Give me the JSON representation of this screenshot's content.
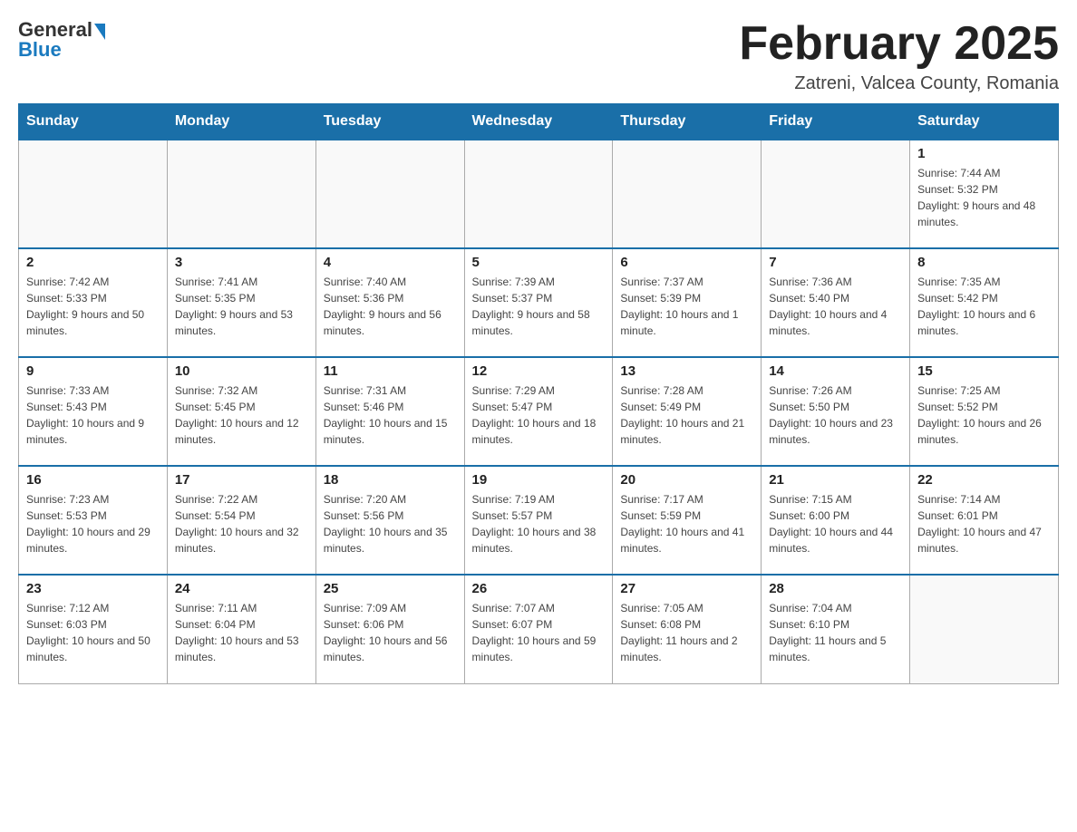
{
  "header": {
    "logo_general": "General",
    "logo_blue": "Blue",
    "title": "February 2025",
    "subtitle": "Zatreni, Valcea County, Romania"
  },
  "days_of_week": [
    "Sunday",
    "Monday",
    "Tuesday",
    "Wednesday",
    "Thursday",
    "Friday",
    "Saturday"
  ],
  "weeks": [
    [
      {
        "day": "",
        "info": ""
      },
      {
        "day": "",
        "info": ""
      },
      {
        "day": "",
        "info": ""
      },
      {
        "day": "",
        "info": ""
      },
      {
        "day": "",
        "info": ""
      },
      {
        "day": "",
        "info": ""
      },
      {
        "day": "1",
        "info": "Sunrise: 7:44 AM\nSunset: 5:32 PM\nDaylight: 9 hours and 48 minutes."
      }
    ],
    [
      {
        "day": "2",
        "info": "Sunrise: 7:42 AM\nSunset: 5:33 PM\nDaylight: 9 hours and 50 minutes."
      },
      {
        "day": "3",
        "info": "Sunrise: 7:41 AM\nSunset: 5:35 PM\nDaylight: 9 hours and 53 minutes."
      },
      {
        "day": "4",
        "info": "Sunrise: 7:40 AM\nSunset: 5:36 PM\nDaylight: 9 hours and 56 minutes."
      },
      {
        "day": "5",
        "info": "Sunrise: 7:39 AM\nSunset: 5:37 PM\nDaylight: 9 hours and 58 minutes."
      },
      {
        "day": "6",
        "info": "Sunrise: 7:37 AM\nSunset: 5:39 PM\nDaylight: 10 hours and 1 minute."
      },
      {
        "day": "7",
        "info": "Sunrise: 7:36 AM\nSunset: 5:40 PM\nDaylight: 10 hours and 4 minutes."
      },
      {
        "day": "8",
        "info": "Sunrise: 7:35 AM\nSunset: 5:42 PM\nDaylight: 10 hours and 6 minutes."
      }
    ],
    [
      {
        "day": "9",
        "info": "Sunrise: 7:33 AM\nSunset: 5:43 PM\nDaylight: 10 hours and 9 minutes."
      },
      {
        "day": "10",
        "info": "Sunrise: 7:32 AM\nSunset: 5:45 PM\nDaylight: 10 hours and 12 minutes."
      },
      {
        "day": "11",
        "info": "Sunrise: 7:31 AM\nSunset: 5:46 PM\nDaylight: 10 hours and 15 minutes."
      },
      {
        "day": "12",
        "info": "Sunrise: 7:29 AM\nSunset: 5:47 PM\nDaylight: 10 hours and 18 minutes."
      },
      {
        "day": "13",
        "info": "Sunrise: 7:28 AM\nSunset: 5:49 PM\nDaylight: 10 hours and 21 minutes."
      },
      {
        "day": "14",
        "info": "Sunrise: 7:26 AM\nSunset: 5:50 PM\nDaylight: 10 hours and 23 minutes."
      },
      {
        "day": "15",
        "info": "Sunrise: 7:25 AM\nSunset: 5:52 PM\nDaylight: 10 hours and 26 minutes."
      }
    ],
    [
      {
        "day": "16",
        "info": "Sunrise: 7:23 AM\nSunset: 5:53 PM\nDaylight: 10 hours and 29 minutes."
      },
      {
        "day": "17",
        "info": "Sunrise: 7:22 AM\nSunset: 5:54 PM\nDaylight: 10 hours and 32 minutes."
      },
      {
        "day": "18",
        "info": "Sunrise: 7:20 AM\nSunset: 5:56 PM\nDaylight: 10 hours and 35 minutes."
      },
      {
        "day": "19",
        "info": "Sunrise: 7:19 AM\nSunset: 5:57 PM\nDaylight: 10 hours and 38 minutes."
      },
      {
        "day": "20",
        "info": "Sunrise: 7:17 AM\nSunset: 5:59 PM\nDaylight: 10 hours and 41 minutes."
      },
      {
        "day": "21",
        "info": "Sunrise: 7:15 AM\nSunset: 6:00 PM\nDaylight: 10 hours and 44 minutes."
      },
      {
        "day": "22",
        "info": "Sunrise: 7:14 AM\nSunset: 6:01 PM\nDaylight: 10 hours and 47 minutes."
      }
    ],
    [
      {
        "day": "23",
        "info": "Sunrise: 7:12 AM\nSunset: 6:03 PM\nDaylight: 10 hours and 50 minutes."
      },
      {
        "day": "24",
        "info": "Sunrise: 7:11 AM\nSunset: 6:04 PM\nDaylight: 10 hours and 53 minutes."
      },
      {
        "day": "25",
        "info": "Sunrise: 7:09 AM\nSunset: 6:06 PM\nDaylight: 10 hours and 56 minutes."
      },
      {
        "day": "26",
        "info": "Sunrise: 7:07 AM\nSunset: 6:07 PM\nDaylight: 10 hours and 59 minutes."
      },
      {
        "day": "27",
        "info": "Sunrise: 7:05 AM\nSunset: 6:08 PM\nDaylight: 11 hours and 2 minutes."
      },
      {
        "day": "28",
        "info": "Sunrise: 7:04 AM\nSunset: 6:10 PM\nDaylight: 11 hours and 5 minutes."
      },
      {
        "day": "",
        "info": ""
      }
    ]
  ]
}
